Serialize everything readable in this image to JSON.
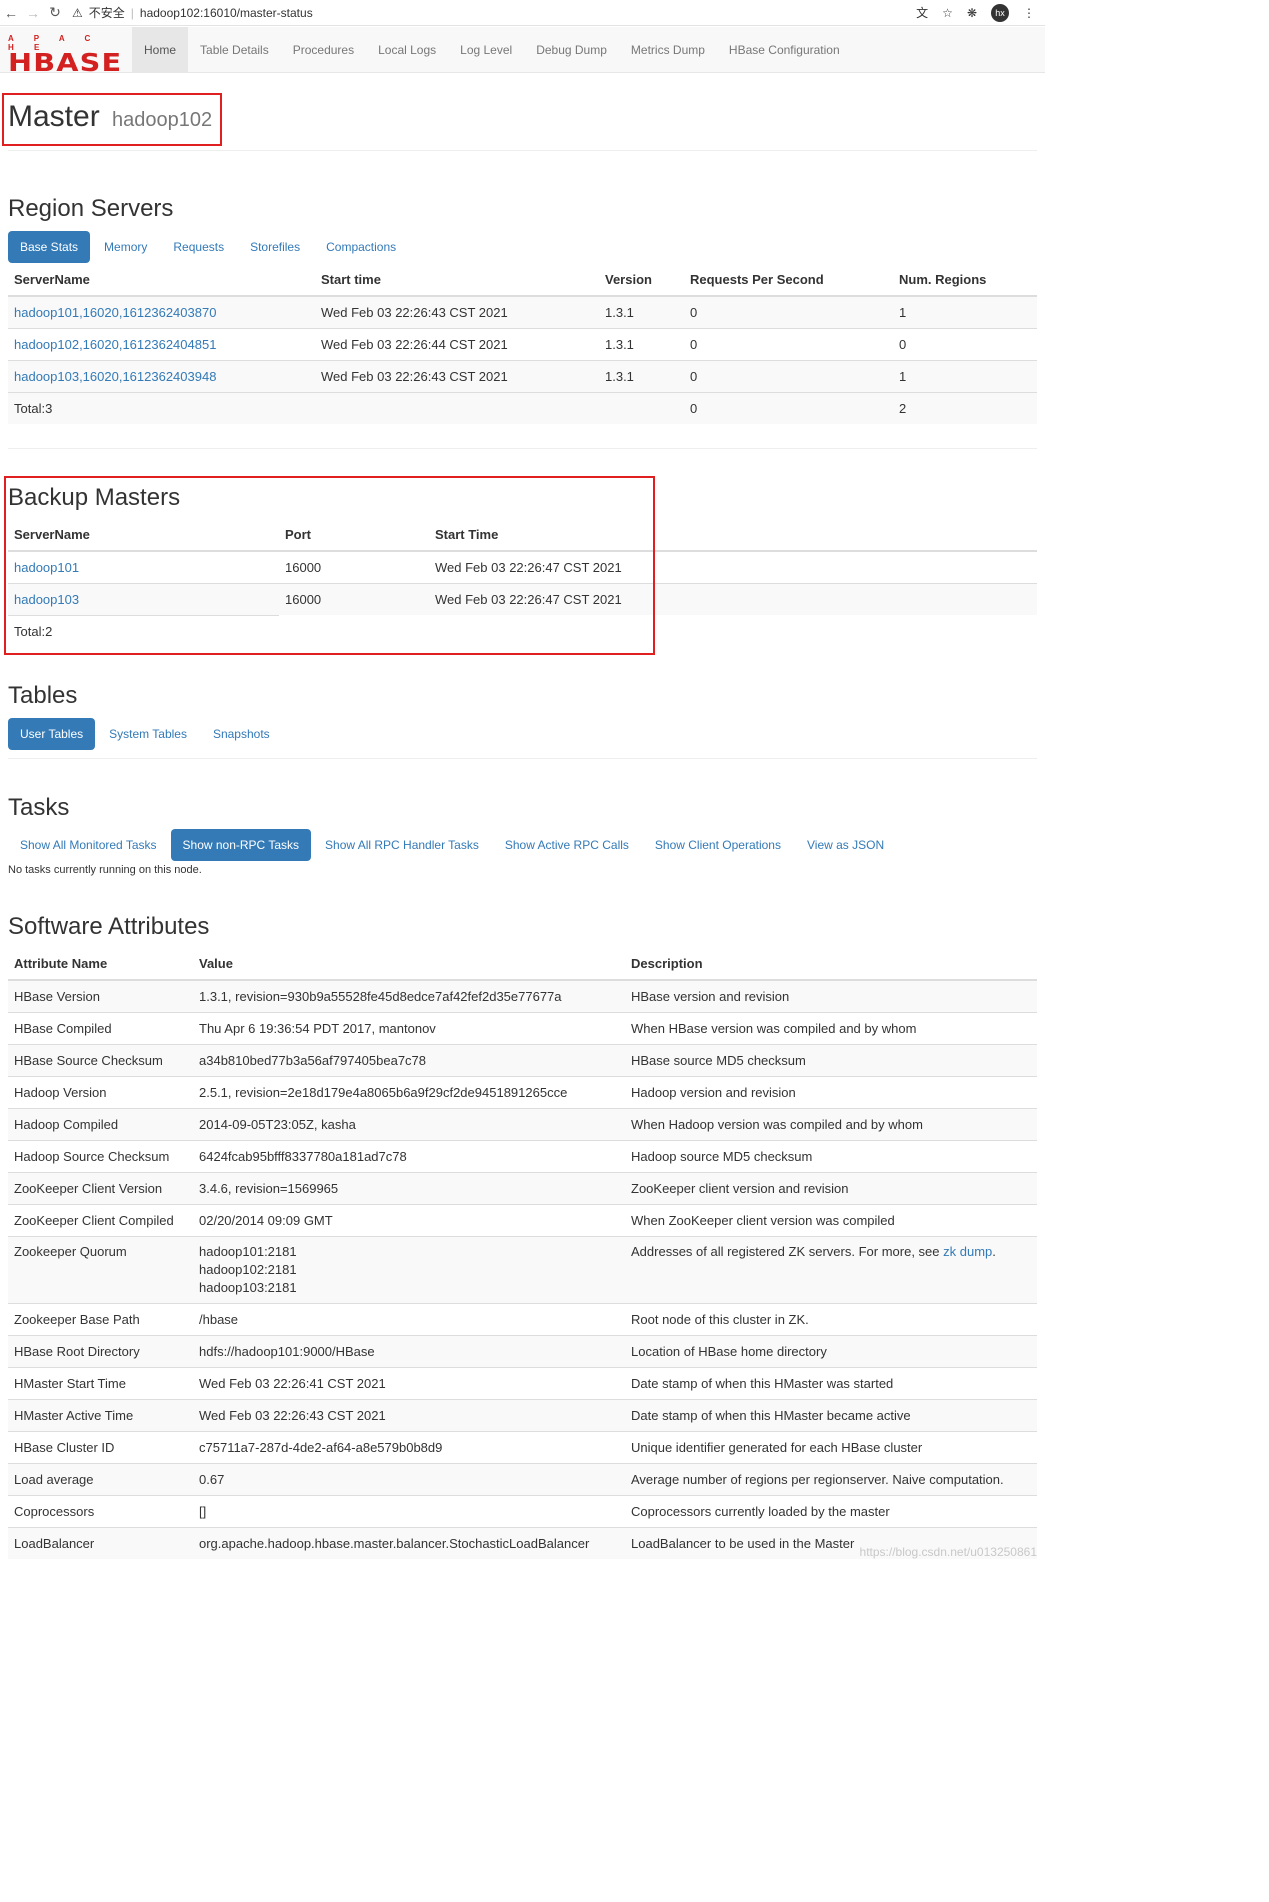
{
  "browser": {
    "security_label": "不安全",
    "url": "hadoop102:16010/master-status",
    "profile": "hx"
  },
  "logo": {
    "top": "A P A C H E",
    "main": "HBASE"
  },
  "nav": [
    "Home",
    "Table Details",
    "Procedures",
    "Local Logs",
    "Log Level",
    "Debug Dump",
    "Metrics Dump",
    "HBase Configuration"
  ],
  "master": {
    "title": "Master",
    "host": "hadoop102"
  },
  "region_servers": {
    "title": "Region Servers",
    "tabs": [
      "Base Stats",
      "Memory",
      "Requests",
      "Storefiles",
      "Compactions"
    ],
    "columns": [
      "ServerName",
      "Start time",
      "Version",
      "Requests Per Second",
      "Num. Regions"
    ],
    "rows": [
      [
        "hadoop101,16020,1612362403870",
        "Wed Feb 03 22:26:43 CST 2021",
        "1.3.1",
        "0",
        "1"
      ],
      [
        "hadoop102,16020,1612362404851",
        "Wed Feb 03 22:26:44 CST 2021",
        "1.3.1",
        "0",
        "0"
      ],
      [
        "hadoop103,16020,1612362403948",
        "Wed Feb 03 22:26:43 CST 2021",
        "1.3.1",
        "0",
        "1"
      ]
    ],
    "total": {
      "label": "Total:3",
      "requests": "0",
      "regions": "2"
    }
  },
  "backup_masters": {
    "title": "Backup Masters",
    "columns": [
      "ServerName",
      "Port",
      "Start Time"
    ],
    "rows": [
      [
        "hadoop101",
        "16000",
        "Wed Feb 03 22:26:47 CST 2021"
      ],
      [
        "hadoop103",
        "16000",
        "Wed Feb 03 22:26:47 CST 2021"
      ]
    ],
    "total": "Total:2"
  },
  "tables": {
    "title": "Tables",
    "tabs": [
      "User Tables",
      "System Tables",
      "Snapshots"
    ]
  },
  "tasks": {
    "title": "Tasks",
    "tabs": [
      "Show All Monitored Tasks",
      "Show non-RPC Tasks",
      "Show All RPC Handler Tasks",
      "Show Active RPC Calls",
      "Show Client Operations",
      "View as JSON"
    ],
    "empty": "No tasks currently running on this node."
  },
  "software": {
    "title": "Software Attributes",
    "columns": [
      "Attribute Name",
      "Value",
      "Description"
    ],
    "rows": [
      [
        "HBase Version",
        "1.3.1, revision=930b9a55528fe45d8edce7af42fef2d35e77677a",
        "HBase version and revision"
      ],
      [
        "HBase Compiled",
        "Thu Apr 6 19:36:54 PDT 2017, mantonov",
        "When HBase version was compiled and by whom"
      ],
      [
        "HBase Source Checksum",
        "a34b810bed77b3a56af797405bea7c78",
        "HBase source MD5 checksum"
      ],
      [
        "Hadoop Version",
        "2.5.1, revision=2e18d179e4a8065b6a9f29cf2de9451891265cce",
        "Hadoop version and revision"
      ],
      [
        "Hadoop Compiled",
        "2014-09-05T23:05Z, kasha",
        "When Hadoop version was compiled and by whom"
      ],
      [
        "Hadoop Source Checksum",
        "6424fcab95bfff8337780a181ad7c78",
        "Hadoop source MD5 checksum"
      ],
      [
        "ZooKeeper Client Version",
        "3.4.6, revision=1569965",
        "ZooKeeper client version and revision"
      ],
      [
        "ZooKeeper Client Compiled",
        "02/20/2014 09:09 GMT",
        "When ZooKeeper client version was compiled"
      ],
      [
        "Zookeeper Quorum",
        "hadoop101:2181\nhadoop102:2181\nhadoop103:2181",
        "Addresses of all registered ZK servers. For more, see "
      ],
      [
        "Zookeeper Base Path",
        "/hbase",
        "Root node of this cluster in ZK."
      ],
      [
        "HBase Root Directory",
        "hdfs://hadoop101:9000/HBase",
        "Location of HBase home directory"
      ],
      [
        "HMaster Start Time",
        "Wed Feb 03 22:26:41 CST 2021",
        "Date stamp of when this HMaster was started"
      ],
      [
        "HMaster Active Time",
        "Wed Feb 03 22:26:43 CST 2021",
        "Date stamp of when this HMaster became active"
      ],
      [
        "HBase Cluster ID",
        "c75711a7-287d-4de2-af64-a8e579b0b8d9",
        "Unique identifier generated for each HBase cluster"
      ],
      [
        "Load average",
        "0.67",
        "Average number of regions per regionserver. Naive computation."
      ],
      [
        "Coprocessors",
        "[]",
        "Coprocessors currently loaded by the master"
      ],
      [
        "LoadBalancer",
        "org.apache.hadoop.hbase.master.balancer.StochasticLoadBalancer",
        "LoadBalancer to be used in the Master"
      ]
    ],
    "zk_link": "zk dump"
  },
  "watermark": "https://blog.csdn.net/u013250861"
}
